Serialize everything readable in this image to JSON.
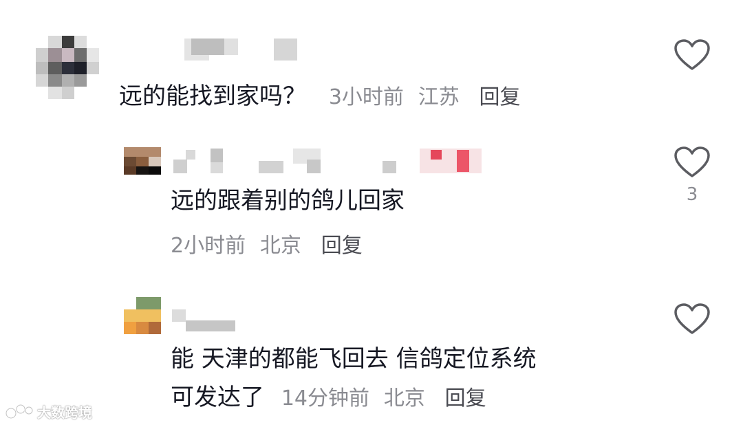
{
  "comments": [
    {
      "text": "远的能找到家吗？",
      "time": "3小时前",
      "location": "江苏",
      "reply_label": "回复",
      "likes": ""
    },
    {
      "text": "远的跟着别的鸽儿回家",
      "time": "2小时前",
      "location": "北京",
      "reply_label": "回复",
      "likes": "3"
    },
    {
      "text_line1": "能 天津的都能飞回去 信鸽定位系统",
      "text_line2": "可发达了",
      "time": "14分钟前",
      "location": "北京",
      "reply_label": "回复",
      "likes": ""
    }
  ],
  "watermark": {
    "text": "大数跨境"
  },
  "colors": {
    "text": "#161823",
    "meta": "#8a8b91",
    "icon": "#5b5c61"
  }
}
